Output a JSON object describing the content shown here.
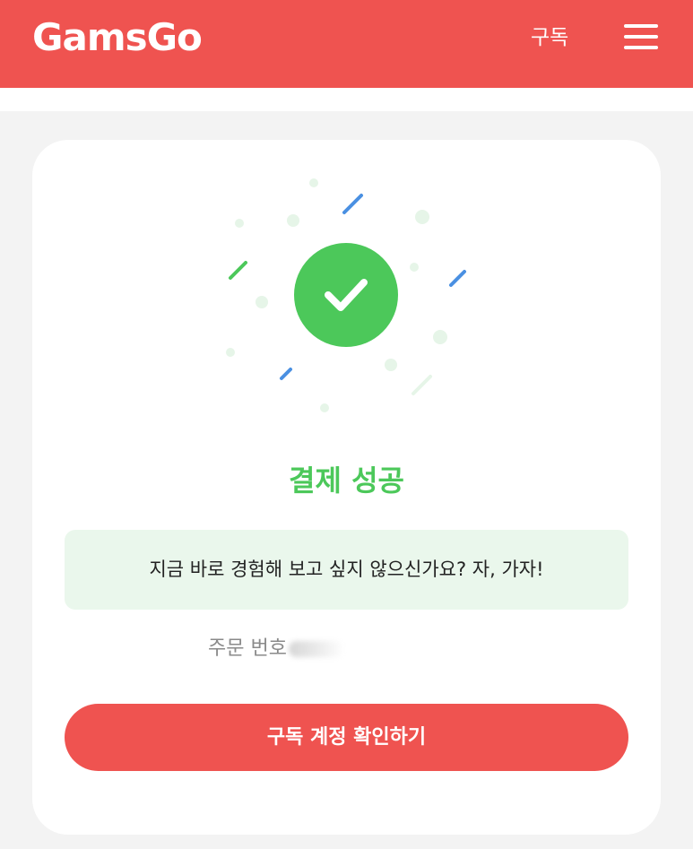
{
  "header": {
    "logo": "GamsGo",
    "nav_link": "구독",
    "menu_icon": "hamburger-menu-icon",
    "background_color": "#ef5350"
  },
  "main": {
    "status_icon": "check-circle-icon",
    "title": "결제 성공",
    "message": "지금 바로 경험해 보고 싶지 않으신가요? 자, 가자!",
    "order_label": "주문 번호",
    "cta_button": "구독 계정 확인하기"
  },
  "colors": {
    "accent_red": "#ef5350",
    "success_green": "#4cc85a",
    "message_bg": "#eaf7ec",
    "confetti_blue": "#4a90e2"
  }
}
